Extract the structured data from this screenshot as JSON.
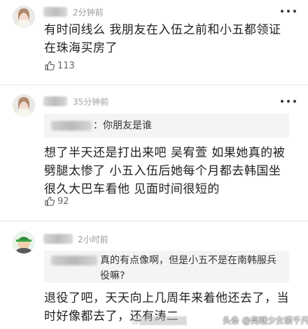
{
  "comments": [
    {
      "time": "2分钟前",
      "text": "有时间线么 我朋友在入伍之前和小五都领证在珠海买房了",
      "likes": "113"
    },
    {
      "time": "35分钟前",
      "quote": "：你朋友是谁",
      "text": "想了半天还是打出来吧 吴宥萱 如果她真的被劈腿太惨了 小五入伍后她每个月都去韩国坐很久大巴车看他 见面时间很短的",
      "likes": "92"
    },
    {
      "time": "2小时前",
      "quote": "真的有点像啊，但是小五不是在南韩服兵役嘛?",
      "text": "退役了吧，天天向上几周年来着他还去了，当时好像都去了，还有涛二"
    }
  ],
  "watermark": {
    "right": "头条 @亮瞎少女裘千尺"
  }
}
